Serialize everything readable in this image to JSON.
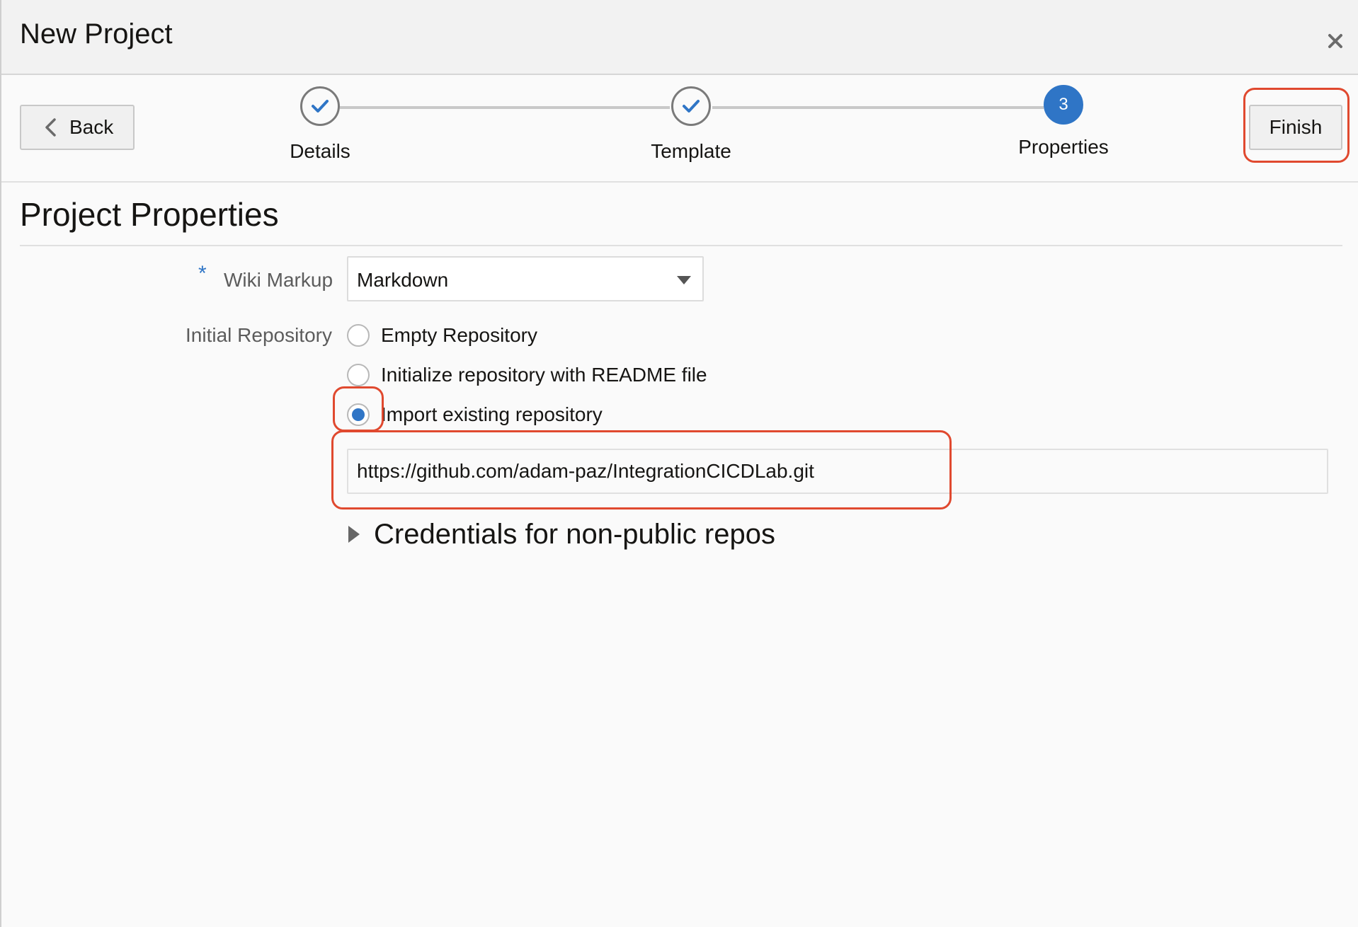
{
  "dialog": {
    "title": "New Project",
    "close_icon": "close-icon"
  },
  "nav": {
    "back_label": "Back",
    "finish_label": "Finish",
    "back_icon": "chevron-left-icon"
  },
  "train": {
    "steps": [
      {
        "label": "Details",
        "state": "completed",
        "icon": "check-icon"
      },
      {
        "label": "Template",
        "state": "completed",
        "icon": "check-icon"
      },
      {
        "label": "Properties",
        "state": "current",
        "number": "3"
      }
    ]
  },
  "form": {
    "section_title": "Project Properties",
    "required_marker": "*",
    "wiki_markup": {
      "label": "Wiki Markup",
      "value": "Markdown"
    },
    "initial_repository": {
      "label": "Initial Repository",
      "options": [
        {
          "label": "Empty Repository",
          "selected": false
        },
        {
          "label": "Initialize repository with README file",
          "selected": false
        },
        {
          "label": "Import existing repository",
          "selected": true
        }
      ],
      "url_value": "https://github.com/adam-paz/IntegrationCICDLab.git"
    },
    "credentials_label": "Credentials for non-public repos"
  },
  "colors": {
    "accent": "#2f75c6",
    "highlight": "#e0492f"
  }
}
